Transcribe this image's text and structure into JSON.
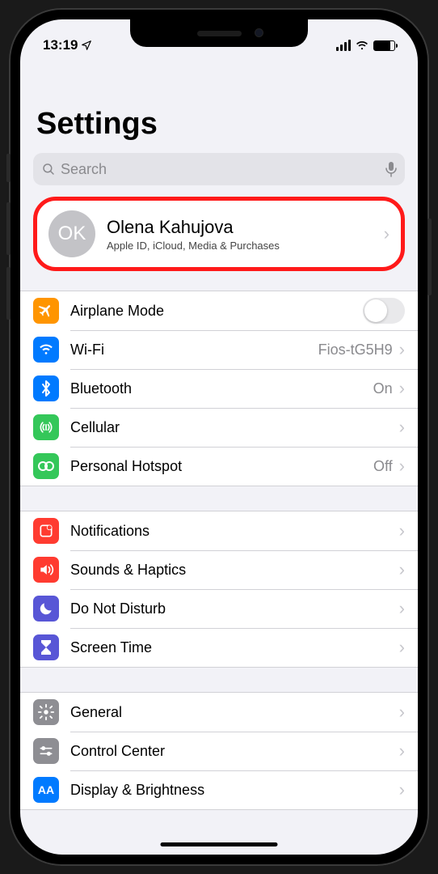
{
  "status": {
    "time": "13:19"
  },
  "page_title": "Settings",
  "search": {
    "placeholder": "Search"
  },
  "profile": {
    "initials": "OK",
    "name": "Olena Kahujova",
    "subtitle": "Apple ID, iCloud, Media & Purchases"
  },
  "groups": [
    {
      "rows": [
        {
          "icon": "airplane",
          "label": "Airplane Mode",
          "value": "",
          "type": "toggle",
          "toggle": false
        },
        {
          "icon": "wifi",
          "label": "Wi-Fi",
          "value": "Fios-tG5H9",
          "type": "nav"
        },
        {
          "icon": "bluetooth",
          "label": "Bluetooth",
          "value": "On",
          "type": "nav"
        },
        {
          "icon": "cellular",
          "label": "Cellular",
          "value": "",
          "type": "nav"
        },
        {
          "icon": "hotspot",
          "label": "Personal Hotspot",
          "value": "Off",
          "type": "nav"
        }
      ]
    },
    {
      "rows": [
        {
          "icon": "notifications",
          "label": "Notifications",
          "value": "",
          "type": "nav"
        },
        {
          "icon": "sounds",
          "label": "Sounds & Haptics",
          "value": "",
          "type": "nav"
        },
        {
          "icon": "dnd",
          "label": "Do Not Disturb",
          "value": "",
          "type": "nav"
        },
        {
          "icon": "screentime",
          "label": "Screen Time",
          "value": "",
          "type": "nav"
        }
      ]
    },
    {
      "rows": [
        {
          "icon": "general",
          "label": "General",
          "value": "",
          "type": "nav"
        },
        {
          "icon": "control",
          "label": "Control Center",
          "value": "",
          "type": "nav"
        },
        {
          "icon": "display",
          "label": "Display & Brightness",
          "value": "",
          "type": "nav"
        }
      ]
    }
  ]
}
